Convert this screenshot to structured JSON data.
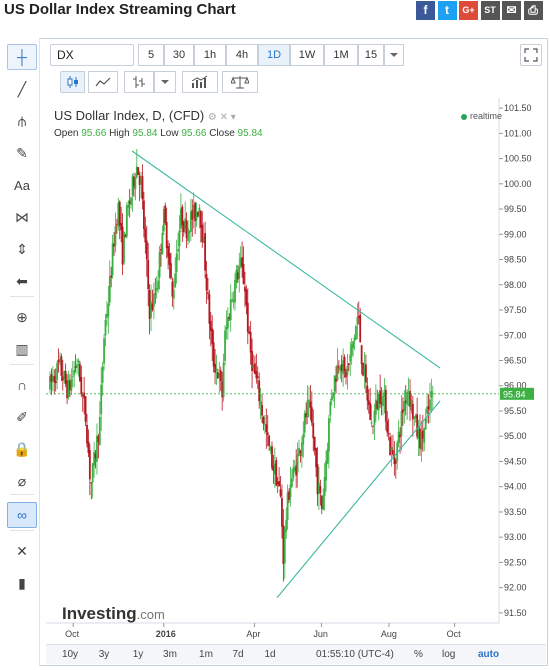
{
  "page": {
    "title": "US Dollar Index Streaming Chart"
  },
  "social": [
    {
      "name": "facebook-icon",
      "glyph": "f",
      "color": "#3b5998"
    },
    {
      "name": "twitter-icon",
      "glyph": "t",
      "color": "#1da1f2"
    },
    {
      "name": "google-plus-icon",
      "glyph": "G+",
      "color": "#dd4b39"
    },
    {
      "name": "stocktwits-icon",
      "glyph": "ST",
      "color": "#555555"
    },
    {
      "name": "email-icon",
      "glyph": "✉",
      "color": "#555555"
    },
    {
      "name": "print-icon",
      "glyph": "⎙",
      "color": "#555555"
    }
  ],
  "toolbar": {
    "symbol": "DX",
    "timeframes": [
      "5",
      "30",
      "1h",
      "4h",
      "1D",
      "1W",
      "1M",
      "15"
    ],
    "selected_timeframe": "1D"
  },
  "left_tools": [
    "crosshair-icon",
    "trendline-icon",
    "pitchfork-icon",
    "brush-icon",
    "text-icon",
    "pattern-icon",
    "measure-icon",
    "arrow-left-icon",
    "zoom-icon",
    "bars-icon",
    "magnet-icon",
    "pencil-lock-icon",
    "lock-icon",
    "eye-hide-icon",
    "link-icon",
    "tools-icon",
    "trash-icon"
  ],
  "legend": {
    "title": "US Dollar Index, D, (CFD)",
    "open_label": "Open",
    "open": "95.66",
    "high_label": "High",
    "high": "95.84",
    "low_label": "Low",
    "low": "95.66",
    "close_label": "Close",
    "close": "95.84",
    "realtime": "realtime"
  },
  "brand": {
    "name": "Investing",
    "suffix": ".com"
  },
  "bottom_bar": {
    "ranges": [
      "10y",
      "3y",
      "1y",
      "3m",
      "1m",
      "7d",
      "1d"
    ],
    "time": "01:55:10 (UTC-4)",
    "percent": "%",
    "log": "log",
    "auto": "auto"
  },
  "colors": {
    "bull": "#3cb043",
    "bear": "#b5161f",
    "trendline": "#3db8a0",
    "last_price_bg": "#3cb043"
  },
  "chart_data": {
    "type": "candlestick",
    "title": "US Dollar Index, D, (CFD)",
    "y_ticks": [
      91.5,
      92.0,
      92.5,
      93.0,
      93.5,
      94.0,
      94.5,
      95.0,
      95.5,
      96.0,
      96.5,
      97.0,
      97.5,
      98.0,
      98.5,
      99.0,
      99.5,
      100.0,
      100.5,
      101.0,
      101.5
    ],
    "ylim": [
      91.3,
      101.7
    ],
    "x_labels": [
      "Oct",
      "2016",
      "Apr",
      "Jun",
      "Aug",
      "Oct"
    ],
    "last_price": 95.84,
    "trendlines": [
      {
        "from": [
          0.19,
          100.65
        ],
        "to": [
          0.87,
          96.35
        ]
      },
      {
        "from": [
          0.51,
          91.8
        ],
        "to": [
          0.87,
          95.7
        ]
      }
    ],
    "price_path": [
      [
        0.0,
        96.0
      ],
      [
        0.02,
        96.4
      ],
      [
        0.04,
        95.9
      ],
      [
        0.06,
        96.5
      ],
      [
        0.08,
        95.3
      ],
      [
        0.09,
        94.0
      ],
      [
        0.11,
        95.3
      ],
      [
        0.12,
        97.1
      ],
      [
        0.13,
        97.8
      ],
      [
        0.14,
        98.8
      ],
      [
        0.15,
        99.6
      ],
      [
        0.16,
        98.6
      ],
      [
        0.17,
        99.4
      ],
      [
        0.18,
        99.8
      ],
      [
        0.19,
        100.4
      ],
      [
        0.2,
        100.1
      ],
      [
        0.21,
        98.8
      ],
      [
        0.22,
        97.5
      ],
      [
        0.23,
        97.7
      ],
      [
        0.24,
        98.3
      ],
      [
        0.25,
        99.4
      ],
      [
        0.26,
        98.8
      ],
      [
        0.27,
        97.7
      ],
      [
        0.28,
        98.7
      ],
      [
        0.29,
        99.4
      ],
      [
        0.3,
        99.1
      ],
      [
        0.31,
        99.3
      ],
      [
        0.32,
        99.4
      ],
      [
        0.33,
        99.6
      ],
      [
        0.34,
        98.7
      ],
      [
        0.35,
        97.5
      ],
      [
        0.36,
        96.5
      ],
      [
        0.37,
        96.3
      ],
      [
        0.38,
        95.8
      ],
      [
        0.385,
        96.9
      ],
      [
        0.4,
        97.7
      ],
      [
        0.41,
        98.1
      ],
      [
        0.42,
        98.4
      ],
      [
        0.43,
        98.0
      ],
      [
        0.44,
        96.8
      ],
      [
        0.45,
        96.3
      ],
      [
        0.46,
        95.9
      ],
      [
        0.47,
        95.4
      ],
      [
        0.48,
        94.9
      ],
      [
        0.49,
        94.5
      ],
      [
        0.5,
        94.2
      ],
      [
        0.51,
        93.7
      ],
      [
        0.515,
        92.6
      ],
      [
        0.52,
        93.3
      ],
      [
        0.53,
        94.1
      ],
      [
        0.54,
        94.3
      ],
      [
        0.55,
        94.7
      ],
      [
        0.56,
        95.2
      ],
      [
        0.57,
        95.6
      ],
      [
        0.58,
        95.1
      ],
      [
        0.59,
        94.1
      ],
      [
        0.6,
        93.6
      ],
      [
        0.61,
        94.6
      ],
      [
        0.62,
        95.8
      ],
      [
        0.63,
        96.2
      ],
      [
        0.64,
        96.6
      ],
      [
        0.65,
        96.2
      ],
      [
        0.66,
        96.4
      ],
      [
        0.67,
        96.9
      ],
      [
        0.68,
        97.4
      ],
      [
        0.69,
        96.4
      ],
      [
        0.7,
        95.8
      ],
      [
        0.71,
        95.2
      ],
      [
        0.72,
        95.6
      ],
      [
        0.73,
        95.9
      ],
      [
        0.74,
        95.6
      ],
      [
        0.75,
        94.8
      ],
      [
        0.76,
        94.5
      ],
      [
        0.77,
        95.0
      ],
      [
        0.78,
        95.6
      ],
      [
        0.79,
        96.0
      ],
      [
        0.8,
        95.5
      ],
      [
        0.81,
        95.1
      ],
      [
        0.82,
        94.9
      ],
      [
        0.83,
        95.3
      ],
      [
        0.84,
        95.7
      ],
      [
        0.845,
        95.84
      ]
    ]
  }
}
